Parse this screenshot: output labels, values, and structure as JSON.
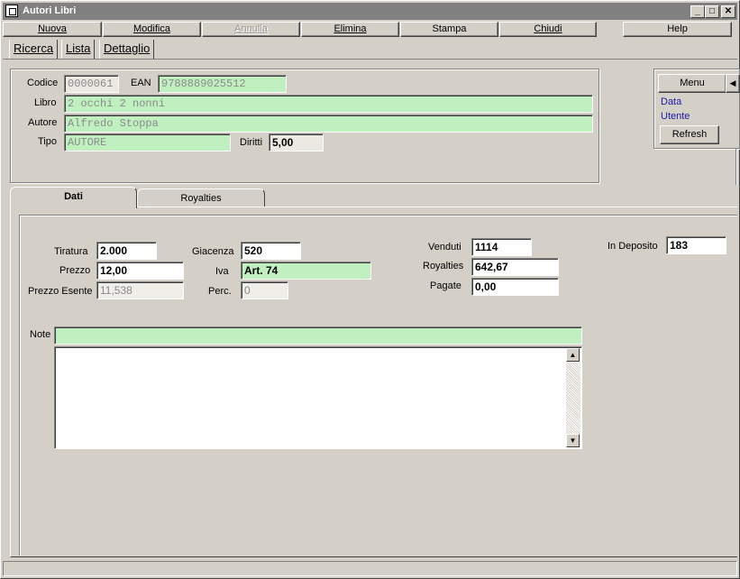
{
  "window": {
    "title": "Autori Libri",
    "controls": [
      "_",
      "□",
      "✕"
    ]
  },
  "toolbar": {
    "nuova": "Nuova",
    "modifica": "Modifica",
    "annulla": "Annulla",
    "elimina": "Elimina",
    "stampa": "Stampa",
    "chiudi": "Chiudi",
    "help": "Help"
  },
  "nav_tabs": {
    "ricerca": "Ricerca",
    "lista": "Lista",
    "dettaglio": "Dettaglio"
  },
  "header": {
    "codice_label": "Codice",
    "codice": "0000061",
    "ean_label": "EAN",
    "ean": "9788889025512",
    "libro_label": "Libro",
    "libro": "2 occhi 2 nonni",
    "autore_label": "Autore",
    "autore": "Alfredo Stoppa",
    "tipo_label": "Tipo",
    "tipo": "AUTORE",
    "diritti_label": "Diritti",
    "diritti": "5,00"
  },
  "side_menu": {
    "menu": "Menu",
    "arrow": "◀",
    "data": "Data",
    "utente": "Utente",
    "refresh": "Refresh"
  },
  "detail_tabs": {
    "dati": "Dati",
    "royalties": "Royalties"
  },
  "dati": {
    "tiratura_label": "Tiratura",
    "tiratura": "2.000",
    "prezzo_label": "Prezzo",
    "prezzo": "12,00",
    "prezzo_esente_label": "Prezzo Esente",
    "prezzo_esente": "11,538",
    "giacenza_label": "Giacenza",
    "giacenza": "520",
    "iva_label": "Iva",
    "iva": "Art. 74",
    "perc_label": "Perc.",
    "perc": "0",
    "venduti_label": "Venduti",
    "venduti": "1114",
    "royalties_label": "Royalties",
    "royalties": "642,67",
    "pagate_label": "Pagate",
    "pagate": "0,00",
    "in_deposito_label": "In Deposito",
    "in_deposito": "183",
    "note_label": "Note",
    "note": "",
    "note_text": ""
  },
  "colors": {
    "field_green": "#c0f0c0",
    "title_inactive": "#808080",
    "link_blue": "#1a1aa6"
  }
}
